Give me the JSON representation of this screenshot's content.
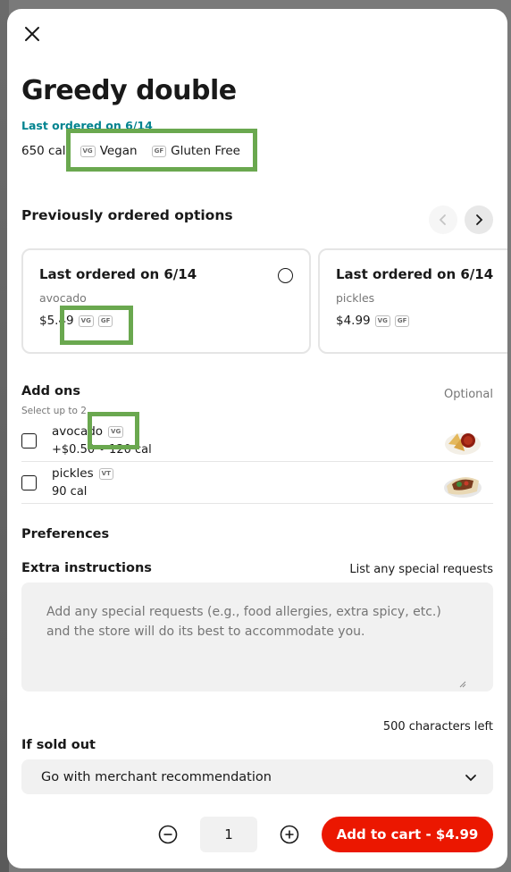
{
  "item": {
    "title": "Greedy double",
    "last_ordered": "Last ordered on 6/14",
    "calories": "650 cal",
    "dietary": [
      {
        "tag": "VG",
        "label": "Vegan"
      },
      {
        "tag": "GF",
        "label": "Gluten Free"
      }
    ]
  },
  "previous": {
    "title": "Previously ordered options",
    "cards": [
      {
        "title": "Last ordered on 6/14",
        "desc": "avocado",
        "price": "$5.49",
        "tags": [
          "VG",
          "GF"
        ]
      },
      {
        "title": "Last ordered on 6/14",
        "desc": "pickles",
        "price": "$4.99",
        "tags": [
          "VG",
          "GF"
        ]
      }
    ]
  },
  "addons": {
    "title": "Add ons",
    "optional": "Optional",
    "hint": "Select up to 2",
    "items": [
      {
        "name": "avocado",
        "tag": "VG",
        "sub": "+$0.50 • 120 cal"
      },
      {
        "name": "pickles",
        "tag": "VT",
        "sub": "90 cal"
      }
    ]
  },
  "preferences": {
    "title": "Preferences",
    "instructions_label": "Extra instructions",
    "instructions_hint": "List any special requests",
    "placeholder": "Add any special requests (e.g., food allergies, extra spicy, etc.) and the store will do its best to accommodate you.",
    "chars_left": "500 characters left"
  },
  "sold_out": {
    "label": "If sold out",
    "selected": "Go with merchant recommendation"
  },
  "footer": {
    "quantity": "1",
    "cart_label": "Add to cart - $4.99"
  },
  "colors": {
    "accent": "#eb1700",
    "link": "#00838f",
    "highlight": "#6aa84f"
  }
}
